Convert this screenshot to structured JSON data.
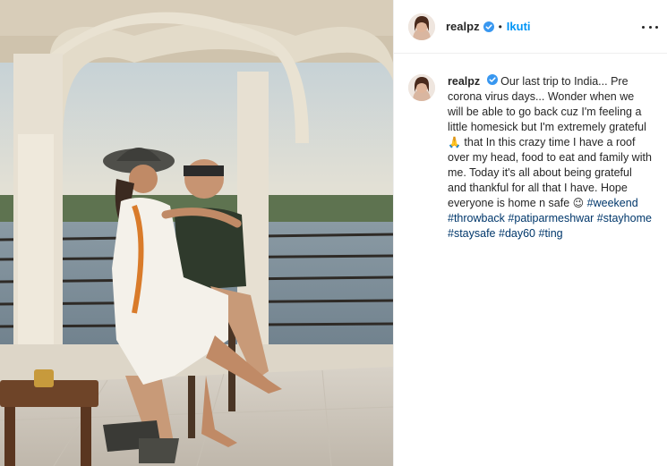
{
  "post": {
    "username": "realpz",
    "follow_label": "Ikuti",
    "separator": "•",
    "more_label": "...",
    "caption_parts": [
      "Our last trip to India... Pre corona virus days... Wonder when we will be able to go back cuz I'm feeling a little homesick but I'm extremely grateful ",
      " that In this crazy time I have a roof over my head, food to eat and family with me. Today it's all about being grateful and thankful for all that I have. Hope everyone is home n safe "
    ],
    "emoji_pray": "🙏",
    "emoji_face": "😉",
    "hashtags": [
      "#weekend",
      "#throwback",
      "#patiparmeshwar",
      "#stayhome",
      "#staysafe",
      "#day60",
      "#ting"
    ]
  },
  "icons": {
    "verified": "verified-badge-icon",
    "more": "more-options-icon"
  },
  "colors": {
    "link_blue": "#0095f6",
    "hashtag": "#00376b",
    "verified": "#3897f0",
    "text": "#262626"
  }
}
